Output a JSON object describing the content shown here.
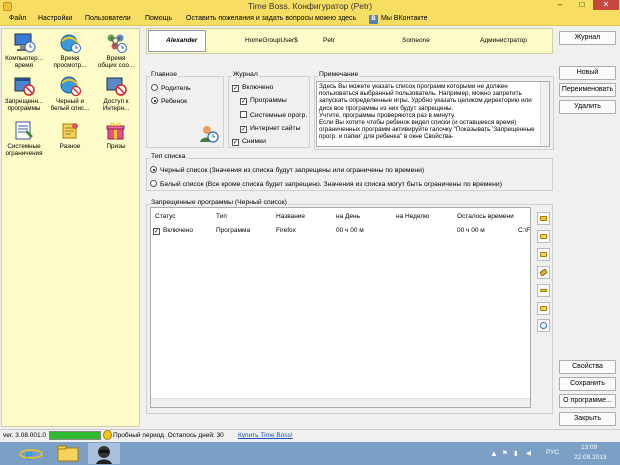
{
  "window": {
    "title": "Time Boss. Конфигуратор (Petr)",
    "minimize": "–",
    "maximize": "□",
    "close": "✕"
  },
  "menu": {
    "items": [
      "Файл",
      "Настройки",
      "Пользователи",
      "Помощь",
      "Оставить пожелания и задать вопросы можно здесь"
    ],
    "vk_badge": "В",
    "vk_label": "Мы ВКонтакте"
  },
  "categories": [
    {
      "label": "Компьютер...\nвремя",
      "icon": "computer-time-icon"
    },
    {
      "label": "Время\nпросмотр...",
      "icon": "internet-time-icon"
    },
    {
      "label": "Время\nобщих соо...",
      "icon": "network-time-icon"
    },
    {
      "label": "Запрещенн...\nпрограммы",
      "icon": "forbidden-programs-icon"
    },
    {
      "label": "Черный и\nбелый спис...",
      "icon": "black-white-list-icon"
    },
    {
      "label": "Доступ к\nИнтерн...",
      "icon": "internet-access-icon"
    },
    {
      "label": "Системные\nограничения",
      "icon": "system-restrictions-icon"
    },
    {
      "label": "Разное",
      "icon": "misc-icon"
    },
    {
      "label": "Призы",
      "icon": "prizes-icon"
    }
  ],
  "users": [
    "Alexander",
    "HomeGroupUser$",
    "Petr",
    "Someone",
    "Администратор"
  ],
  "right_buttons": {
    "journal": "Журнал",
    "new": "Новый",
    "rename": "Переименовать",
    "delete": "Удалить"
  },
  "main_group": {
    "title": "Главное",
    "parent": "Родитель",
    "child": "Ребенок"
  },
  "journal_group": {
    "title": "Журнал",
    "enabled": "Включено",
    "programs": "Программы",
    "system_progs": "Системные прогр.",
    "internet_sites": "Интернет сайты",
    "snapshots": "Снимки"
  },
  "note_group": {
    "title": "Примечание",
    "text": "Здесь Вы можете указать список программ  которыми не должен пользоваться выбранный пользователь. Например, можно запретить запускать определенные игры. Удобно указать целиком директорию или диск все программы из них будут запрещены.\nУчтите, программы проверяются раз в минуту.\nЕсли Вы хотите чтобы ребенок видел списки (и оставшееся время) ограниченных программ активируйте галочку \"Показывать 'Запрещенные прогр. и папки' для ребенка\" в окне Свойства-"
  },
  "list_type": {
    "title": "Тип списка",
    "black": "Черный список (Значения из списка будут запрещены или ограничены по времени)",
    "white": "Белый список (Все кроме списка будет запрещено. Значения из списка могут быть ограничены по времени)"
  },
  "programs_group": {
    "title": "Запрещенные программы (Черный список)",
    "columns": [
      "Статус",
      "Тип",
      "Название",
      "на День",
      "на Неделю",
      "Осталось времени",
      ""
    ],
    "rows": [
      {
        "status": "Включено",
        "type": "Программа",
        "name": "Firefox",
        "day": "00 ч 00 м",
        "week": "",
        "remaining": "00 ч 00 м",
        "path": "C:\\F"
      }
    ]
  },
  "bottom_buttons": {
    "properties": "Свойства",
    "save": "Сохранить",
    "about": "О программе...",
    "close": "Закрыть"
  },
  "status": {
    "version": "ver. 3.08.001.0",
    "progress_percent": 100,
    "trial": "Пробный период. Осталось дней: 30",
    "buy_link": "Купить Time Boss!"
  },
  "taskbar": {
    "lang": "РУС",
    "time": "13:09",
    "date": "22.09.2013"
  },
  "colors": {
    "accent_yellow": "#f7de62",
    "panel_cream": "#fdfbc7",
    "progress_green": "#2fba2f",
    "taskbar_blue": "#7b9fc5"
  }
}
